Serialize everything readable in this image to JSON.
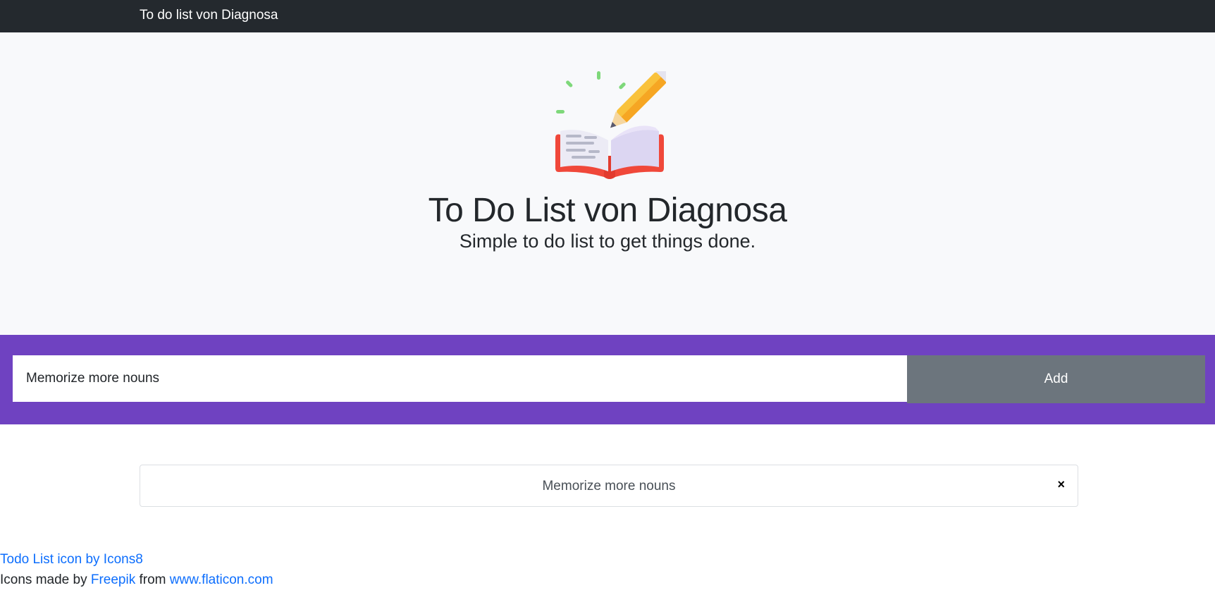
{
  "navbar": {
    "brand": "To do list von Diagnosa"
  },
  "hero": {
    "icon": "todo-book-pencil-icon",
    "title": "To Do List von Diagnosa",
    "subtitle": "Simple to do list to get things done."
  },
  "form": {
    "input_value": "Memorize more nouns",
    "add_label": "Add"
  },
  "todos": [
    {
      "text": "Memorize more nouns",
      "delete_label": "×"
    }
  ],
  "footer": {
    "line1_link": "Todo List icon by Icons8",
    "line2_prefix": "Icons made by ",
    "line2_author": "Freepik",
    "line2_middle": " from ",
    "line2_site": "www.flaticon.com"
  },
  "colors": {
    "navbar": "#24292e",
    "hero_bg": "#f8f9fb",
    "form_band": "#6f42c1",
    "add_button": "#6c757d",
    "link": "#0d6efd"
  }
}
